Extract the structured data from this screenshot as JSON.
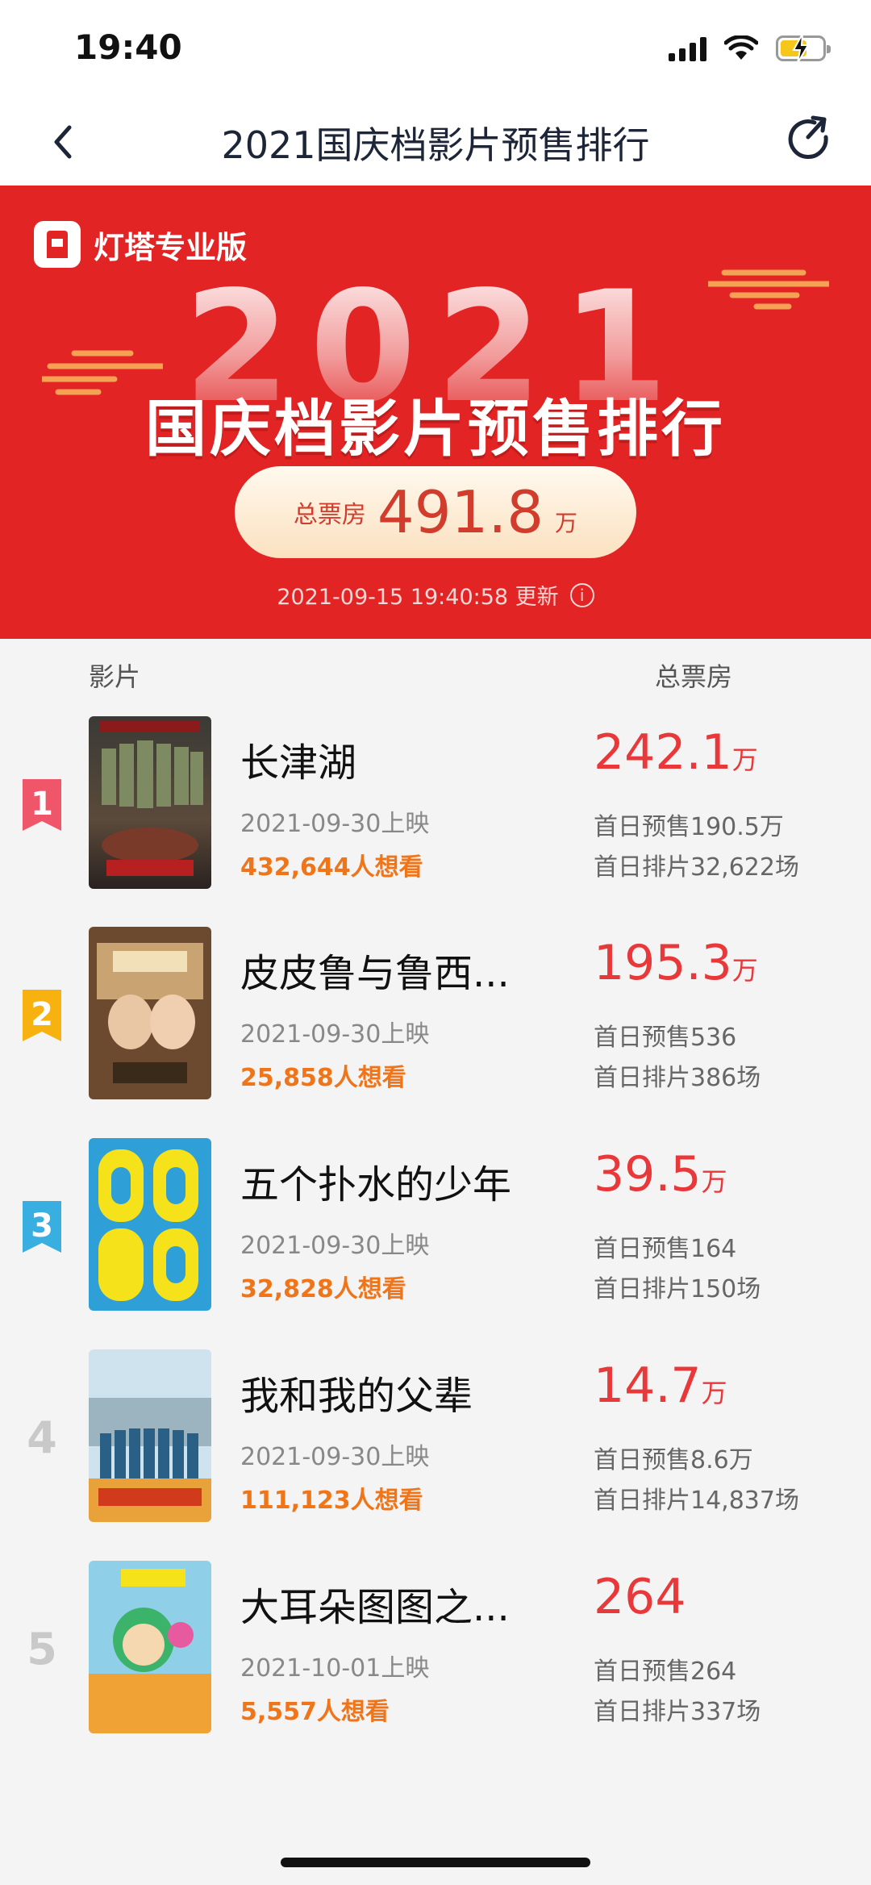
{
  "status_bar": {
    "time": "19:40"
  },
  "nav": {
    "title": "2021国庆档影片预售排行"
  },
  "banner": {
    "brand": "灯塔专业版",
    "year": "2021",
    "title": "国庆档影片预售排行",
    "total_label": "总票房",
    "total_value": "491.8",
    "total_unit": "万",
    "update_time": "2021-09-15 19:40:58 更新",
    "accent_color": "#e22424"
  },
  "list_header": {
    "film": "影片",
    "box_office": "总票房"
  },
  "films": [
    {
      "rank": "1",
      "badge_color": "#f0566a",
      "title": "长津湖",
      "release": "2021-09-30上映",
      "want": "432,644人想看",
      "box": "242.1",
      "box_unit": "万",
      "presale": "首日预售190.5万",
      "schedule": "首日排片32,622场"
    },
    {
      "rank": "2",
      "badge_color": "#f7b20f",
      "title": "皮皮鲁与鲁西...",
      "release": "2021-09-30上映",
      "want": "25,858人想看",
      "box": "195.3",
      "box_unit": "万",
      "presale": "首日预售536",
      "schedule": "首日排片386场"
    },
    {
      "rank": "3",
      "badge_color": "#39aee0",
      "title": "五个扑水的少年",
      "release": "2021-09-30上映",
      "want": "32,828人想看",
      "box": "39.5",
      "box_unit": "万",
      "presale": "首日预售164",
      "schedule": "首日排片150场"
    },
    {
      "rank": "4",
      "title": "我和我的父辈",
      "release": "2021-09-30上映",
      "want": "111,123人想看",
      "box": "14.7",
      "box_unit": "万",
      "presale": "首日预售8.6万",
      "schedule": "首日排片14,837场"
    },
    {
      "rank": "5",
      "title": "大耳朵图图之...",
      "release": "2021-10-01上映",
      "want": "5,557人想看",
      "box": "264",
      "box_unit": "",
      "presale": "首日预售264",
      "schedule": "首日排片337场"
    }
  ]
}
